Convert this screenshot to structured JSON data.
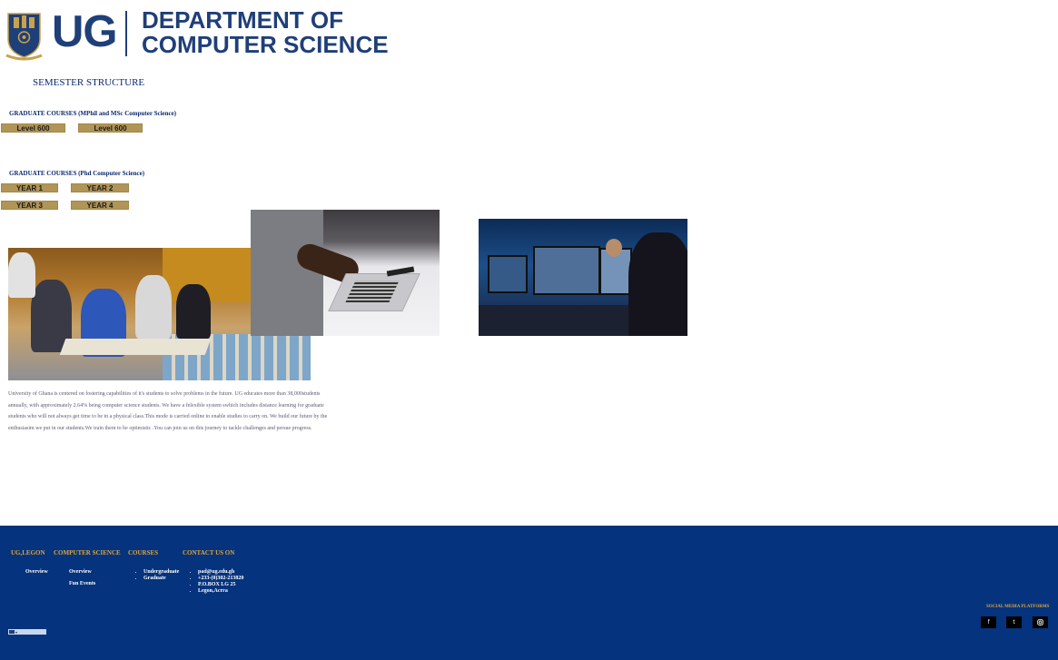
{
  "header": {
    "logo_text": "UG",
    "dept_line1": "DEPARTMENT OF",
    "dept_line2": "COMPUTER SCIENCE"
  },
  "semester": {
    "title": "SEMESTER STRUCTURE",
    "graduate_mphil_label": "GRADUATE COURSES (MPhil and MSc Computer Science)",
    "graduate_mphil_buttons": [
      "Level 600",
      "Level 600"
    ],
    "graduate_phd_label": "GRADUATE COURSES (Phd Computer Science)",
    "graduate_phd_buttons": [
      "YEAR 1",
      "YEAR 2",
      "YEAR 3",
      "YEAR 4"
    ]
  },
  "about": {
    "text": "University of Ghana is centered on fostering capabilities of it's students to solve problems in the future. UG educates more than 38,000students annually, with approximately 2.64% being computer science students. We have a felexible system swhich includes distance learning for graduate students who will not always get time to be in a physical class.This mode is carried online to enable studies to carry on. We build our future by the enthusiasim we put in our students.We train them to be optimistic .You can join us on this journey to tackle challenges and persue progress."
  },
  "footer": {
    "col1": {
      "heading": "UG,LEGON",
      "links": [
        "Overview"
      ]
    },
    "col2": {
      "heading": "COMPUTER SCIENCE",
      "links": [
        "Overview",
        "Fun Events"
      ]
    },
    "col3": {
      "heading": "COURSES",
      "items": [
        "Undergraduate",
        "Graduate"
      ]
    },
    "col4": {
      "heading": "CONTACT US ON",
      "items": [
        "pad@ug.edu.gh",
        "+233-(0)302-213820",
        "P.O.BOX LG 25",
        "Legon,Acrra"
      ]
    },
    "social_label": "SOCIAL MEDIA PLATFORMS",
    "social": [
      "f",
      "t",
      "ig"
    ]
  },
  "colors": {
    "brand_blue": "#1f3f78",
    "footer_blue": "#05337d",
    "gold": "#b09556",
    "footer_heading": "#e0a53a"
  }
}
